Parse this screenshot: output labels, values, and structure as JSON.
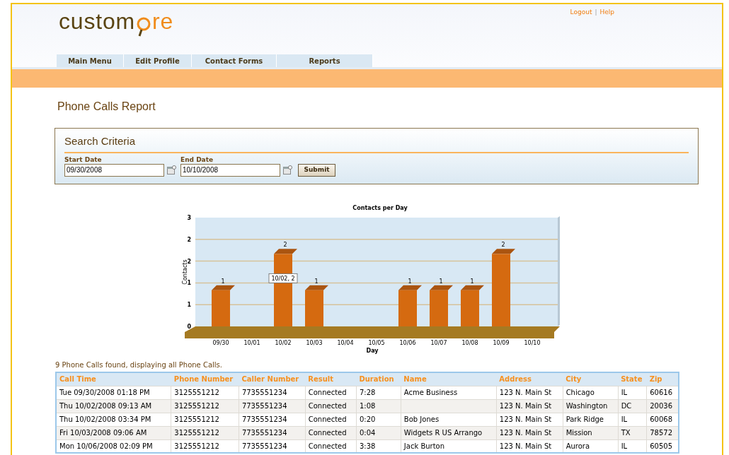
{
  "logo": {
    "before": "custom",
    "after": "re"
  },
  "top_links": [
    "Logout",
    "Help"
  ],
  "link_separator": "|",
  "nav": [
    "Main Menu",
    "Edit Profile",
    "Contact Forms",
    "Reports"
  ],
  "page_title": "Phone Calls Report",
  "search": {
    "title": "Search Criteria",
    "fields": [
      {
        "label": "Start Date",
        "value": "09/30/2008"
      },
      {
        "label": "End Date",
        "value": "10/10/2008"
      }
    ],
    "submit": "Submit"
  },
  "chart_data": {
    "type": "bar",
    "title": "Contacts per Day",
    "xlabel": "Day",
    "ylabel": "Contacts",
    "categories": [
      "09/30",
      "10/01",
      "10/02",
      "10/03",
      "10/04",
      "10/05",
      "10/06",
      "10/07",
      "10/08",
      "10/09",
      "10/10"
    ],
    "values": [
      1,
      0,
      2,
      1,
      0,
      0,
      1,
      1,
      1,
      2,
      0
    ],
    "ylim": [
      0,
      3
    ],
    "yticks": [
      {
        "value": 0,
        "label": "0"
      },
      {
        "value": 0.6,
        "label": "1"
      },
      {
        "value": 1.2,
        "label": "1"
      },
      {
        "value": 1.8,
        "label": "2"
      },
      {
        "value": 2.4,
        "label": "2"
      },
      {
        "value": 3,
        "label": "3"
      }
    ],
    "grid": true,
    "value_labels": [
      "1",
      null,
      "2",
      "1",
      null,
      null,
      "1",
      "1",
      "1",
      "2",
      null
    ],
    "annotations": [
      "10/02, 2"
    ]
  },
  "summary": "9 Phone Calls found, displaying all Phone Calls.",
  "table": {
    "columns": [
      "Call Time",
      "Phone Number",
      "Caller Number",
      "Result",
      "Duration",
      "Name",
      "Address",
      "City",
      "State",
      "Zip"
    ],
    "rows": [
      [
        "Tue 09/30/2008 01:18 PM",
        "3125551212",
        "7735551234",
        "Connected",
        "7:28",
        "Acme Business",
        "123 N. Main St",
        "Chicago",
        "IL",
        "60616"
      ],
      [
        "Thu 10/02/2008 09:13 AM",
        "3125551212",
        "7735551234",
        "Connected",
        "1:08",
        "",
        "123 N. Main St",
        "Washington",
        "DC",
        "20036"
      ],
      [
        "Thu 10/02/2008 03:34 PM",
        "3125551212",
        "7735551234",
        "Connected",
        "0:20",
        "Bob Jones",
        "123 N. Main St",
        "Park Ridge",
        "IL",
        "60068"
      ],
      [
        "Fri 10/03/2008 09:06 AM",
        "3125551212",
        "7735551234",
        "Connected",
        "0:04",
        "Widgets R US Arrango",
        "123 N. Main St",
        "Mission",
        "TX",
        "78572"
      ],
      [
        "Mon 10/06/2008 02:09 PM",
        "3125551212",
        "7735551234",
        "Connected",
        "3:38",
        "Jack Burton",
        "123 N. Main St",
        "Aurora",
        "IL",
        "60505"
      ]
    ]
  }
}
